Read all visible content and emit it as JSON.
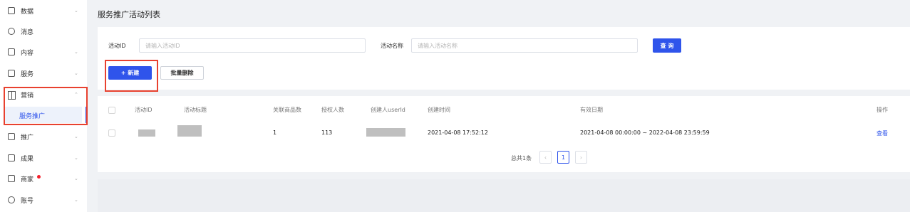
{
  "sidebar": {
    "items": [
      {
        "label": "数据"
      },
      {
        "label": "消息"
      },
      {
        "label": "内容"
      },
      {
        "label": "服务"
      },
      {
        "label": "营销"
      },
      {
        "label": "推广"
      },
      {
        "label": "成果"
      },
      {
        "label": "商家"
      },
      {
        "label": "账号"
      }
    ],
    "active_sub_item": "服务推广",
    "chevron_down": "⌄",
    "chevron_up": "⌃"
  },
  "page": {
    "title": "服务推广活动列表"
  },
  "filters": {
    "activity_id_label": "活动ID",
    "activity_id_placeholder": "请输入活动ID",
    "activity_name_label": "活动名称",
    "activity_name_placeholder": "请输入活动名称",
    "search_button": "查 询"
  },
  "actions": {
    "new_button": "+ 新建",
    "batch_delete_button": "批量删除"
  },
  "table": {
    "columns": [
      "活动ID",
      "活动标题",
      "关联商品数",
      "授权人数",
      "创建人userId",
      "创建时间",
      "有效日期",
      "操作"
    ],
    "rows": [
      {
        "product_count": "1",
        "authorized_count": "113",
        "created_time": "2021-04-08 17:52:12",
        "valid_period": "2021-04-08 00:00:00 ~ 2022-04-08 23:59:59",
        "action": "查看"
      }
    ]
  },
  "pagination": {
    "total": "总共1条",
    "prev": "‹",
    "current_page": "1",
    "next": "›"
  },
  "colors": {
    "accent": "#2f54eb",
    "highlight_box": "#e8412f",
    "badge": "#f5222d"
  }
}
